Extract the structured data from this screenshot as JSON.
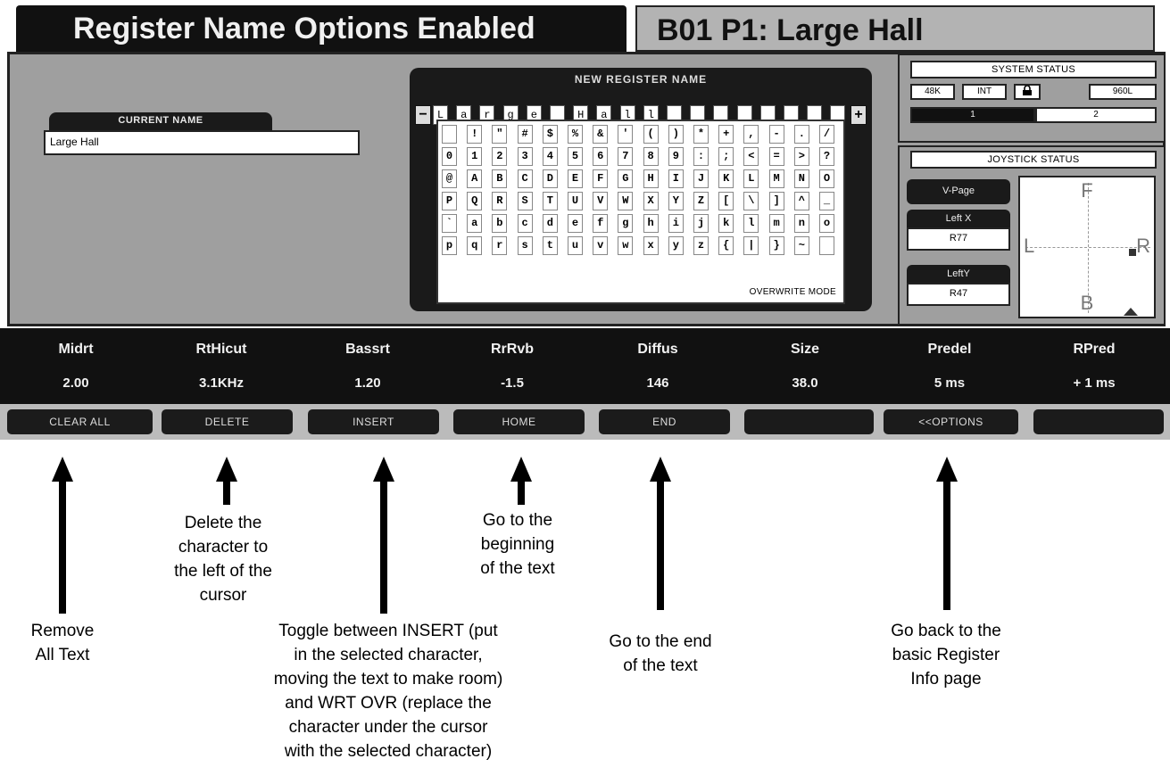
{
  "title": {
    "main": "Register Name Options Enabled",
    "program": "B01 P1: Large Hall"
  },
  "current_name": {
    "label": "CURRENT NAME",
    "value": "Large Hall"
  },
  "new_register_name": {
    "label": "NEW REGISTER NAME",
    "minus": "−",
    "plus": "+",
    "chars": [
      "L",
      "a",
      "r",
      "g",
      "e",
      "",
      "H",
      "a",
      "l",
      "l",
      "",
      "",
      "",
      "",
      "",
      "",
      "",
      ""
    ],
    "mode": "OVERWRITE MODE",
    "rows": [
      [
        "",
        " !",
        "\"",
        "#",
        "$",
        "%",
        "&",
        "'",
        "(",
        ")",
        "*",
        "+",
        ",",
        "-",
        ".",
        "/"
      ],
      [
        "0",
        "1",
        "2",
        "3",
        "4",
        "5",
        "6",
        "7",
        "8",
        "9",
        ":",
        ";",
        "<",
        "=",
        ">",
        "?"
      ],
      [
        "@",
        "A",
        "B",
        "C",
        "D",
        "E",
        "F",
        "G",
        "H",
        "I",
        "J",
        "K",
        "L",
        "M",
        "N",
        "O"
      ],
      [
        "P",
        "Q",
        "R",
        "S",
        "T",
        "U",
        "V",
        "W",
        "X",
        "Y",
        "Z",
        "[",
        "\\",
        "]",
        "^",
        "_"
      ],
      [
        "`",
        "a",
        "b",
        "c",
        "d",
        "e",
        "f",
        "g",
        "h",
        "i",
        "j",
        "k",
        "l",
        "m",
        "n",
        "o"
      ],
      [
        "p",
        "q",
        "r",
        "s",
        "t",
        "u",
        "v",
        "w",
        "x",
        "y",
        "z",
        "{",
        "|",
        "}",
        "~",
        ""
      ]
    ]
  },
  "system_status": {
    "label": "SYSTEM STATUS",
    "rate": "48K",
    "clock": "INT",
    "lock_icon": "lock-icon",
    "model": "960L",
    "machines": [
      "1",
      "2"
    ]
  },
  "joystick_status": {
    "label": "JOYSTICK STATUS",
    "page_button": "V-Page",
    "left_x_label": "Left X",
    "left_x_value": "R77",
    "left_y_label": "LeftY",
    "left_y_value": "R47",
    "dir_front": "F",
    "dir_left": "L",
    "dir_right": "R",
    "dir_back": "B"
  },
  "params": [
    {
      "label": "Midrt",
      "value": "2.00"
    },
    {
      "label": "RtHicut",
      "value": "3.1KHz"
    },
    {
      "label": "Bassrt",
      "value": "1.20"
    },
    {
      "label": "RrRvb",
      "value": "-1.5"
    },
    {
      "label": "Diffus",
      "value": "146"
    },
    {
      "label": "Size",
      "value": "38.0"
    },
    {
      "label": "Predel",
      "value": "5 ms"
    },
    {
      "label": "RPred",
      "value": "+ 1 ms"
    }
  ],
  "softkeys": [
    "CLEAR ALL",
    "DELETE",
    "INSERT",
    "HOME",
    "END",
    "",
    "<<OPTIONS",
    ""
  ],
  "annotations": {
    "clear_all": "Remove\nAll Text",
    "delete": "Delete the\ncharacter to\nthe left of the\ncursor",
    "insert": "Toggle between INSERT (put\nin the selected character,\nmoving the text to make room)\nand WRT OVR (replace the\ncharacter under the cursor\nwith the selected character)",
    "home": "Go to the\nbeginning\nof the text",
    "end": "Go to the end\nof the text",
    "options": "Go back to the\nbasic Register\nInfo page"
  }
}
